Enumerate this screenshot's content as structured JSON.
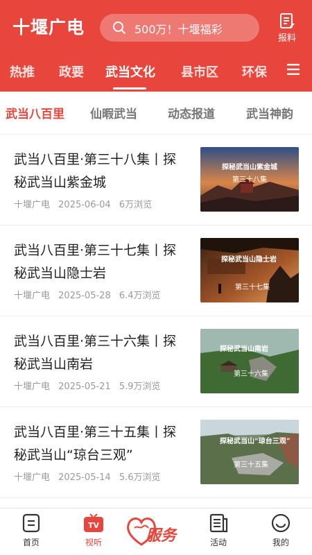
{
  "header": {
    "app_title": "十堰广电",
    "search_placeholder": "500万！十堰福彩",
    "report_label": "报料"
  },
  "channel_tabs": [
    {
      "label": "热推"
    },
    {
      "label": "政要"
    },
    {
      "label": "武当文化",
      "active": true
    },
    {
      "label": "县市区"
    },
    {
      "label": "环保"
    }
  ],
  "sub_tabs": [
    {
      "label": "武当八百里",
      "active": true
    },
    {
      "label": "仙暇武当"
    },
    {
      "label": "动态报道"
    },
    {
      "label": "武当神韵"
    }
  ],
  "articles": [
    {
      "title": "武当八百里·第三十八集丨探秘武当山紫金城",
      "source": "十堰广电",
      "date": "2025-06-04",
      "views": "6万浏览",
      "thumb_title": "探秘武当山紫金城",
      "thumb_episode": "第三十八集"
    },
    {
      "title": "武当八百里·第三十七集丨探秘武当山隐士岩",
      "source": "十堰广电",
      "date": "2025-05-28",
      "views": "6.4万浏览",
      "thumb_title": "探秘武当山隐士岩",
      "thumb_episode": "第三十七集"
    },
    {
      "title": "武当八百里·第三十六集丨探秘武当山南岩",
      "source": "十堰广电",
      "date": "2025-05-21",
      "views": "5.9万浏览",
      "thumb_title": "探秘武当山南岩",
      "thumb_episode": "第三十六集"
    },
    {
      "title": "武当八百里·第三十五集丨探秘武当山“琼台三观”",
      "source": "十堰广电",
      "date": "2025-05-14",
      "views": "5.6万浏览",
      "thumb_title": "探秘武当山“琼台三观”",
      "thumb_episode": "第三十五集"
    }
  ],
  "bottom_nav": {
    "home": "首页",
    "video": "视听",
    "service": "服务",
    "activity": "活动",
    "mine": "我的",
    "tv_badge": "TV"
  },
  "colors": {
    "brand_red": "#e8453c",
    "text_dark": "#222222",
    "text_meta": "#9a9a9a",
    "tab_inactive": "#777777"
  }
}
